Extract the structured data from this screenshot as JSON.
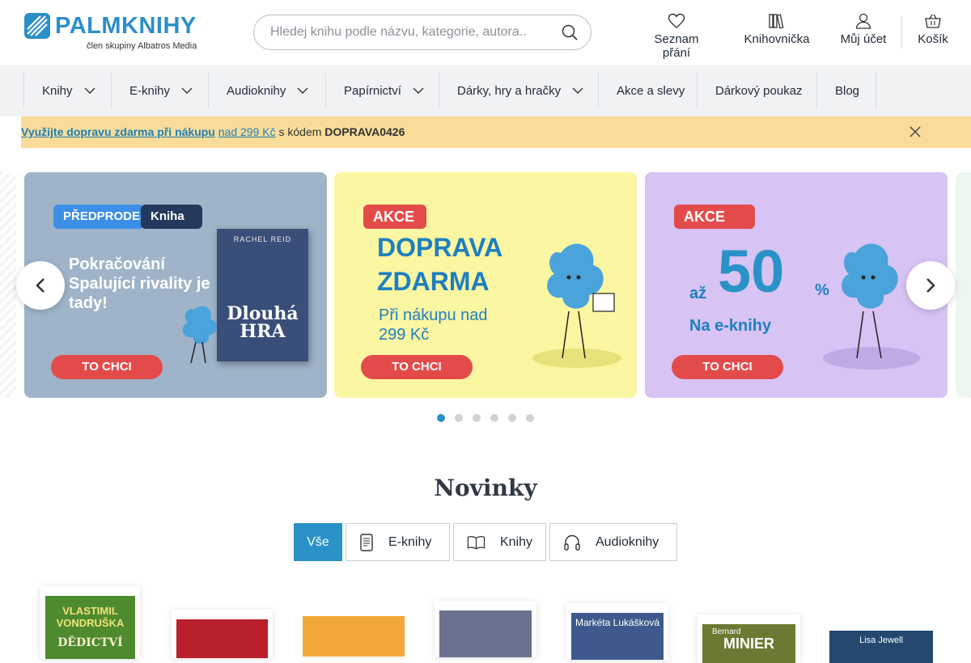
{
  "header": {
    "logo_part1": "PALM",
    "logo_part2": "KNIHY",
    "logo_sub": "člen skupiny Albatros Media",
    "search_placeholder": "Hledej knihu podle názvu, kategorie, autora..",
    "nav": [
      {
        "label": "Seznam přání",
        "icon": "heart-icon"
      },
      {
        "label": "Knihovnička",
        "icon": "books-icon"
      },
      {
        "label": "Můj účet",
        "icon": "user-icon"
      },
      {
        "label": "Košík",
        "icon": "basket-icon"
      }
    ]
  },
  "menu": {
    "items": [
      {
        "label": "Knihy",
        "dropdown": true
      },
      {
        "label": "E-knihy",
        "dropdown": true
      },
      {
        "label": "Audioknihy",
        "dropdown": true
      },
      {
        "label": "Papírnictví",
        "dropdown": true
      },
      {
        "label": "Dárky, hry a hračky",
        "dropdown": true
      },
      {
        "label": "Akce a slevy",
        "dropdown": false
      },
      {
        "label": "Dárkový poukaz",
        "dropdown": false
      },
      {
        "label": "Blog",
        "dropdown": false
      }
    ]
  },
  "promo": {
    "link": "Využijte dopravu zdarma při nákupu",
    "threshold": "nad 299 Kč",
    "middle": "s kódem",
    "code": "DOPRAVA0426"
  },
  "banners": [
    {
      "tag1": "PŘEDPRODEJ",
      "tag2": "Kniha",
      "text": "Pokračování Spalující rivality je tady!",
      "book_author": "RACHEL REID",
      "book_title": "Dlouhá HRA",
      "cta": "TO CHCI"
    },
    {
      "tag": "AKCE",
      "headline": "DOPRAVA ZDARMA",
      "sub": "Při nákupu nad 299 Kč",
      "cta": "TO CHCI"
    },
    {
      "tag": "AKCE",
      "prefix": "až",
      "big": "50",
      "percent": "%",
      "sub": "Na e-knihy",
      "cta": "TO CHCI"
    }
  ],
  "slider": {
    "slides": 6,
    "active": 1
  },
  "novinky": {
    "title": "Novinky",
    "tabs": [
      {
        "label": "Vše",
        "icon": ""
      },
      {
        "label": "E-knihy",
        "icon": "ereader-icon"
      },
      {
        "label": "Knihy",
        "icon": "open-book-icon"
      },
      {
        "label": "Audioknihy",
        "icon": "headphones-icon"
      }
    ],
    "active_tab": 0,
    "books": [
      {
        "author": "VLASTIMIL VONDRUŠKA",
        "title": "DĚDICTVÍ"
      },
      {
        "author": "",
        "title": ""
      },
      {
        "author": "",
        "title": "„"
      },
      {
        "author": "",
        "title": ""
      },
      {
        "author": "Markéta Lukášková",
        "title": ""
      },
      {
        "author": "Bernard",
        "title": "MINIER"
      },
      {
        "author": "Lisa Jewell",
        "title": ""
      }
    ]
  },
  "colors": {
    "brand": "#2c8fc8",
    "accent": "#2a92c6",
    "promo_bg": "#f9dc9a",
    "cta_red": "#e34b4b"
  }
}
